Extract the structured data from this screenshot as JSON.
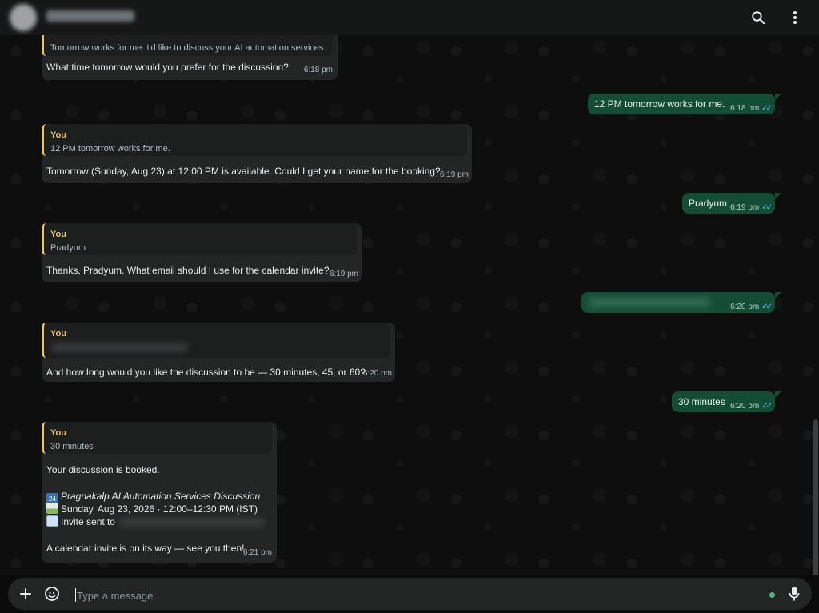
{
  "composer": {
    "placeholder": "Type a message"
  },
  "messages": {
    "m1": {
      "quote_text": "Tomorrow works for me. I'd like to discuss your AI automation services.",
      "text": "What time tomorrow would you prefer for the discussion?",
      "time": "6:18 pm"
    },
    "m2": {
      "text": "12 PM tomorrow works for me.",
      "time": "6:18 pm"
    },
    "m3": {
      "quote_author": "You",
      "quote_text": "12 PM tomorrow works for me.",
      "text": "Tomorrow (Sunday, Aug 23) at 12:00 PM is available. Could I get your name for the booking?",
      "time": "6:19 pm"
    },
    "m4": {
      "text": "Pradyum",
      "time": "6:19 pm"
    },
    "m5": {
      "quote_author": "You",
      "quote_text": "Pradyum",
      "text": "Thanks, Pradyum. What email should I use for the calendar invite?",
      "time": "6:19 pm"
    },
    "m6": {
      "time": "6:20 pm"
    },
    "m7": {
      "quote_author": "You",
      "text": "And how long would you like the discussion to be — 30 minutes, 45, or 60?",
      "time": "6:20 pm"
    },
    "m8": {
      "text": "30 minutes",
      "time": "6:20 pm"
    },
    "m9": {
      "quote_author": "You",
      "quote_text": "30 minutes",
      "line1": "Your discussion is booked.",
      "event_title": "Pragnakalp AI Automation Services Discussion",
      "event_time": "Sunday, Aug 23, 2026 · 12:00–12:30 PM (IST)",
      "invite": "Invite sent to",
      "closing": "A calendar invite is on its way — see you then!",
      "time": "6:21 pm"
    }
  },
  "icons": {
    "search": "search-icon",
    "menu": "more-vertical-icon",
    "add": "plus-icon",
    "sticker": "sticker-icon",
    "mic": "microphone-icon",
    "read": "double-check-icon"
  },
  "colors": {
    "incoming_bubble": "#242626",
    "outgoing_bubble": "#144d37",
    "quote_accent": "#e9c46a",
    "read_ticks": "#53bdeb"
  }
}
